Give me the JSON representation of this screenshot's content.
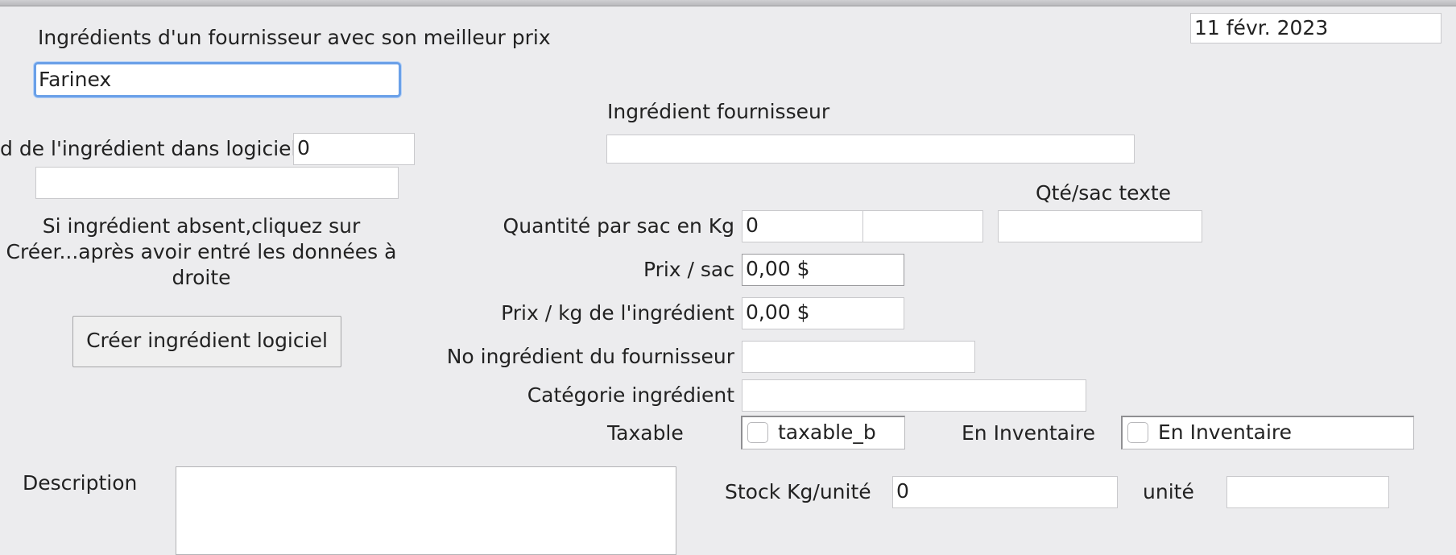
{
  "header": {
    "title": "Ingrédients d'un fournisseur avec son meilleur prix",
    "date": "11 févr. 2023"
  },
  "supplier": {
    "value": "Farinex"
  },
  "left": {
    "id_label": "d de l'ingrédient dans logiciel",
    "id_value": "0",
    "name_value": "",
    "hint_line1": "Si ingrédient absent,cliquez sur",
    "hint_line2": "Créer...après avoir entré les données à",
    "hint_line3": "droite",
    "create_button": "Créer ingrédient logiciel"
  },
  "right": {
    "supplier_ingredient_label": "Ingrédient fournisseur",
    "supplier_ingredient_value": "",
    "qty_text_label": "Qté/sac texte",
    "qty_bag_label": "Quantité par sac en Kg",
    "qty_bag_value": "0",
    "qty_bag_extra": "",
    "qty_text_value": "",
    "price_bag_label": "Prix / sac",
    "price_bag_value": "0,00 $",
    "price_kg_label": "Prix / kg de l'ingrédient",
    "price_kg_value": "0,00 $",
    "supplier_no_label": "No ingrédient du fournisseur",
    "supplier_no_value": "",
    "category_label": "Catégorie ingrédient",
    "category_value": "",
    "taxable_label": "Taxable",
    "taxable_checkbox": "taxable_b",
    "inventory_label": "En Inventaire",
    "inventory_checkbox": "En Inventaire",
    "stock_label": "Stock Kg/unité",
    "stock_value": "0",
    "unit_label": "unité",
    "unit_value": ""
  },
  "description": {
    "label": "Description",
    "value": ""
  }
}
